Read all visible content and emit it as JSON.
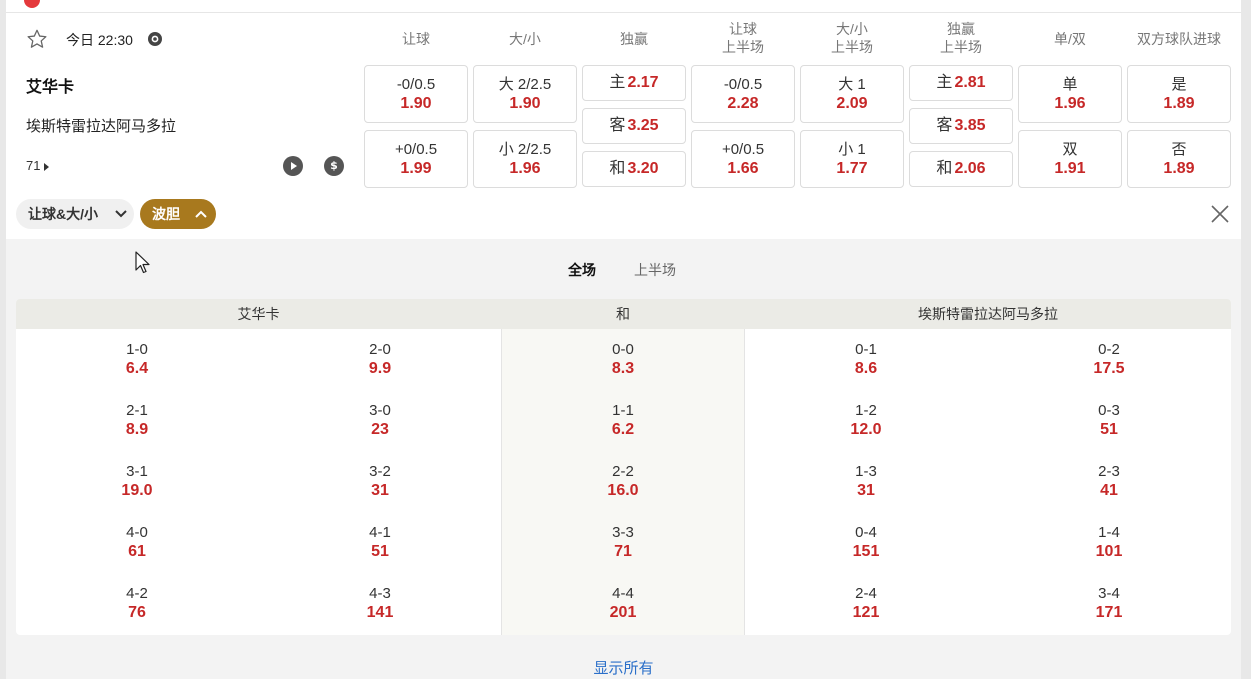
{
  "header": {
    "time": "今日 22:30",
    "columns": [
      "让球",
      "大/小",
      "独赢",
      "让球\n上半场",
      "大/小\n上半场",
      "独赢\n上半场",
      "单/双",
      "双方球队进球"
    ]
  },
  "match": {
    "home": "艾华卡",
    "away": "埃斯特雷拉达阿马多拉",
    "more_count": "71"
  },
  "odds": {
    "handicap": [
      {
        "label": "-0/0.5",
        "value": "1.90"
      },
      {
        "label": "+0/0.5",
        "value": "1.99"
      }
    ],
    "over_under": [
      {
        "label": "大 2/2.5",
        "value": "1.90"
      },
      {
        "label": "小 2/2.5",
        "value": "1.96"
      }
    ],
    "moneyline": [
      {
        "label": "主",
        "value": "2.17"
      },
      {
        "label": "客",
        "value": "3.25"
      },
      {
        "label": "和",
        "value": "3.20"
      }
    ],
    "handicap_half": [
      {
        "label": "-0/0.5",
        "value": "2.28"
      },
      {
        "label": "+0/0.5",
        "value": "1.66"
      }
    ],
    "over_under_half": [
      {
        "label": "大 1",
        "value": "2.09"
      },
      {
        "label": "小 1",
        "value": "1.77"
      }
    ],
    "moneyline_half": [
      {
        "label": "主",
        "value": "2.81"
      },
      {
        "label": "客",
        "value": "3.85"
      },
      {
        "label": "和",
        "value": "2.06"
      }
    ],
    "odd_even": [
      {
        "label": "单",
        "value": "1.96"
      },
      {
        "label": "双",
        "value": "1.91"
      }
    ],
    "btts": [
      {
        "label": "是",
        "value": "1.89"
      },
      {
        "label": "否",
        "value": "1.89"
      }
    ]
  },
  "filters": {
    "pill1": "让球&大/小",
    "pill2": "波胆"
  },
  "panel": {
    "tab_full": "全场",
    "tab_half": "上半场",
    "head_home": "艾华卡",
    "head_draw": "和",
    "head_away": "埃斯特雷拉达阿马多拉",
    "home_col1": [
      {
        "s": "1-0",
        "o": "6.4"
      },
      {
        "s": "2-1",
        "o": "8.9"
      },
      {
        "s": "3-1",
        "o": "19.0"
      },
      {
        "s": "4-0",
        "o": "61"
      },
      {
        "s": "4-2",
        "o": "76"
      }
    ],
    "home_col2": [
      {
        "s": "2-0",
        "o": "9.9"
      },
      {
        "s": "3-0",
        "o": "23"
      },
      {
        "s": "3-2",
        "o": "31"
      },
      {
        "s": "4-1",
        "o": "51"
      },
      {
        "s": "4-3",
        "o": "141"
      }
    ],
    "draw_col": [
      {
        "s": "0-0",
        "o": "8.3"
      },
      {
        "s": "1-1",
        "o": "6.2"
      },
      {
        "s": "2-2",
        "o": "16.0"
      },
      {
        "s": "3-3",
        "o": "71"
      },
      {
        "s": "4-4",
        "o": "201"
      }
    ],
    "away_col1": [
      {
        "s": "0-1",
        "o": "8.6"
      },
      {
        "s": "1-2",
        "o": "12.0"
      },
      {
        "s": "1-3",
        "o": "31"
      },
      {
        "s": "0-4",
        "o": "151"
      },
      {
        "s": "2-4",
        "o": "121"
      }
    ],
    "away_col2": [
      {
        "s": "0-2",
        "o": "17.5"
      },
      {
        "s": "0-3",
        "o": "51"
      },
      {
        "s": "2-3",
        "o": "41"
      },
      {
        "s": "1-4",
        "o": "101"
      },
      {
        "s": "3-4",
        "o": "171"
      }
    ],
    "show_all": "显示所有"
  },
  "colors": {
    "odds_red": "#c62828",
    "accent_gold": "#a8791e",
    "link_blue": "#2a6fc9"
  }
}
